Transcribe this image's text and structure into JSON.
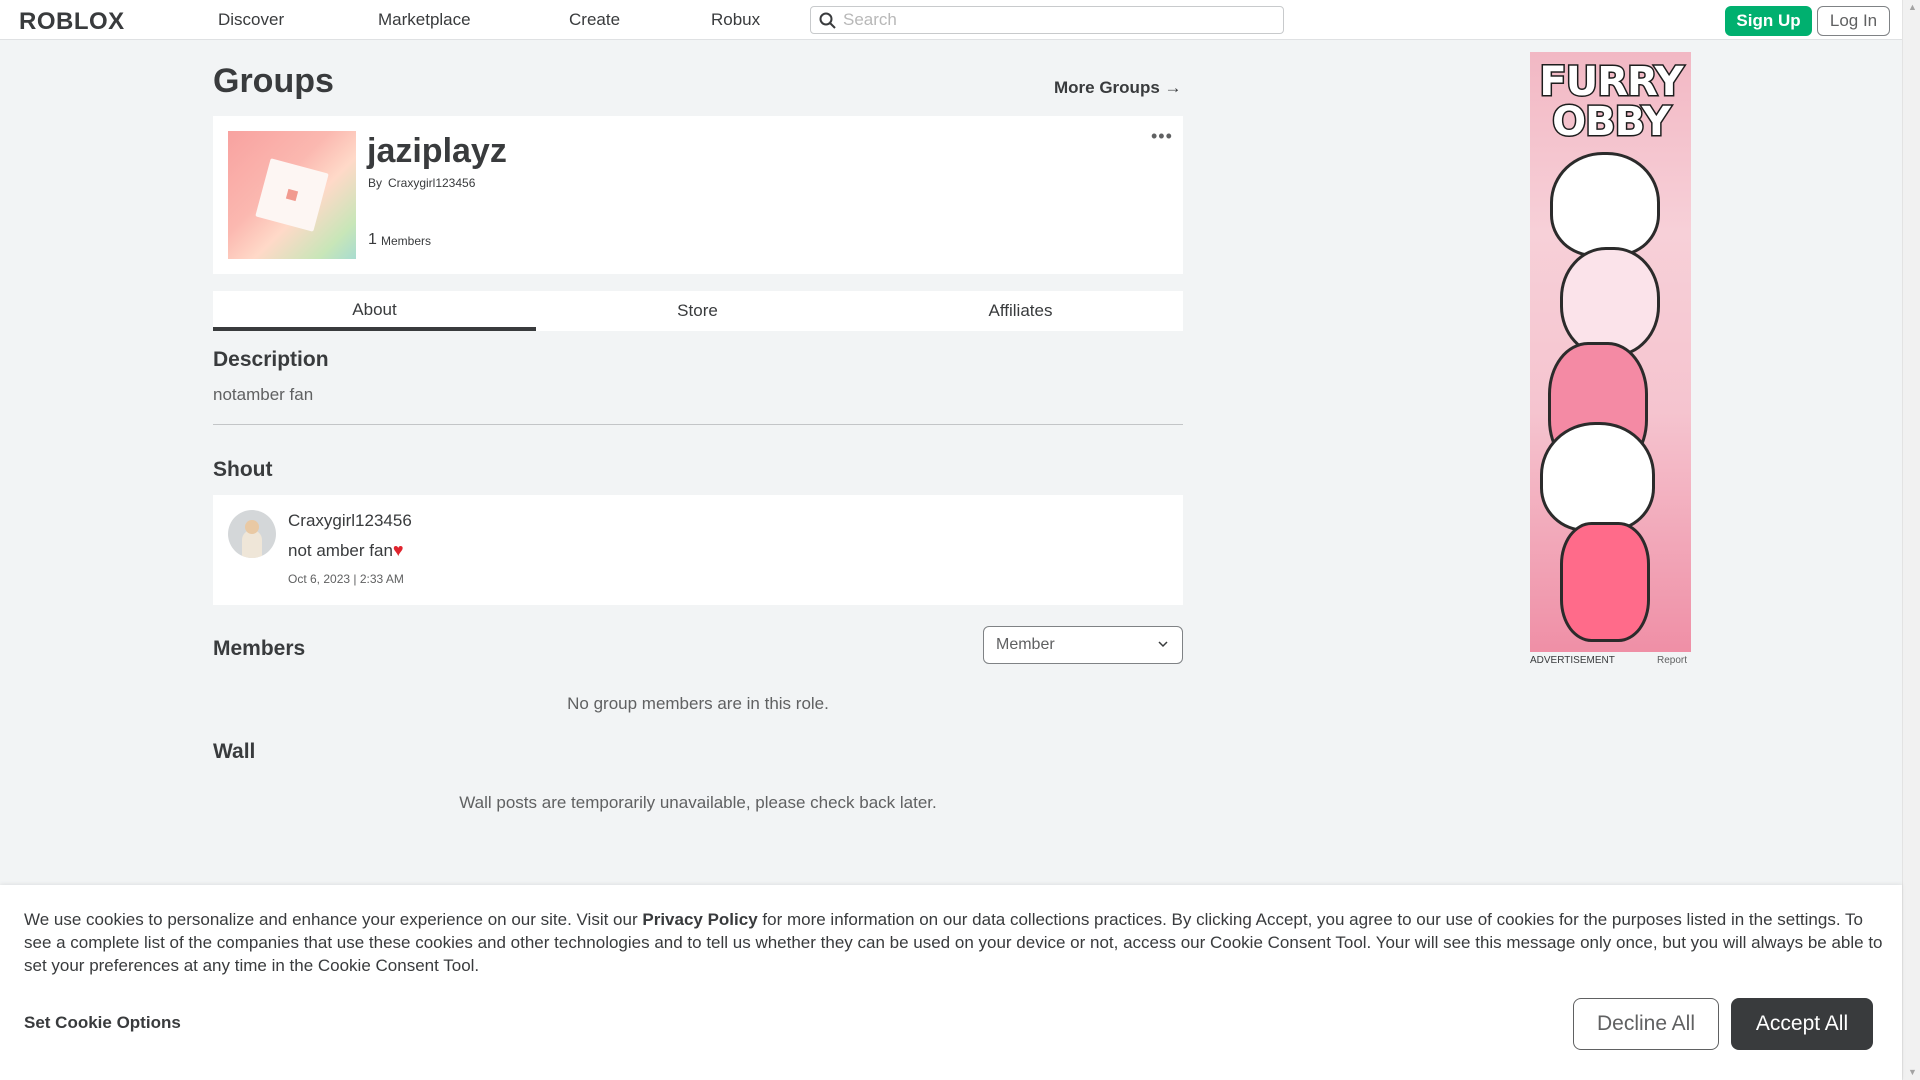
{
  "nav": {
    "logo": "ROBLOX",
    "links": [
      "Discover",
      "Marketplace",
      "Create",
      "Robux"
    ],
    "search_placeholder": "Search",
    "signup": "Sign Up",
    "login": "Log In"
  },
  "page": {
    "title": "Groups",
    "more_groups": "More Groups →"
  },
  "group": {
    "name": "jaziplayz",
    "by_label": "By",
    "owner": "Craxygirl123456",
    "member_count": "1",
    "members_label": "Members",
    "more_icon": "•••"
  },
  "tabs": [
    "About",
    "Store",
    "Affiliates"
  ],
  "description": {
    "heading": "Description",
    "text": "notamber fan"
  },
  "shout": {
    "heading": "Shout",
    "user": "Craxygirl123456",
    "message": "not amber fan",
    "heart": "♥",
    "date": "Oct 6, 2023 | 2:33 AM"
  },
  "members": {
    "heading": "Members",
    "role_selected": "Member",
    "empty": "No group members are in this role."
  },
  "wall": {
    "heading": "Wall",
    "message": "Wall posts are temporarily unavailable, please check back later."
  },
  "ad": {
    "title_line1": "FURRY",
    "title_line2": "OBBY",
    "label": "ADVERTISEMENT",
    "report": "Report"
  },
  "cookie": {
    "text_before": "We use cookies to personalize and enhance your experience on our site. Visit our ",
    "privacy_link": "Privacy Policy",
    "text_after": " for more information on our data collections practices. By clicking Accept, you agree to our use of cookies for the purposes listed in the settings. To see a complete list of the companies that use these cookies and other technologies and to tell us whether they can be used on your device or not, access our Cookie Consent Tool. Your will see this message only once, but you will always be able to set your preferences at any time in the Cookie Consent Tool.",
    "options": "Set Cookie Options",
    "decline": "Decline All",
    "accept": "Accept All"
  },
  "colors": {
    "signup_green": "#00b06f",
    "text_dark": "#393b3d",
    "heart_red": "#e0242e"
  }
}
